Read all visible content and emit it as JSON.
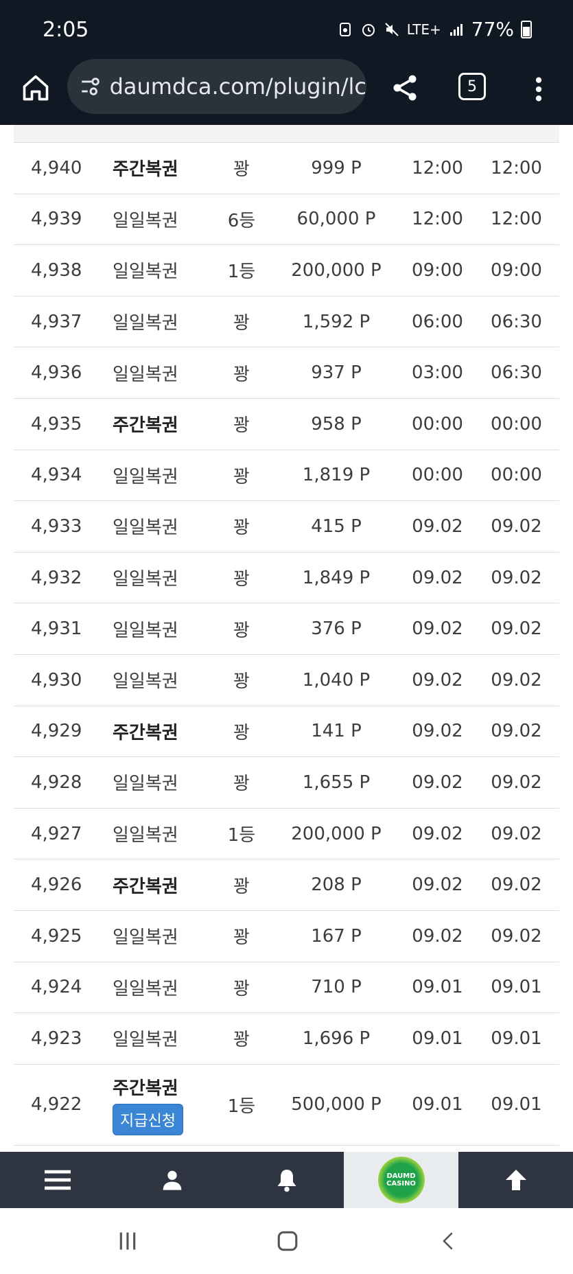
{
  "status": {
    "time": "2:05",
    "network": "LTE+",
    "battery": "77%"
  },
  "browser": {
    "url": "daumdca.com/plugin/lc",
    "tab_count": "5"
  },
  "rows": [
    {
      "no": "4,940",
      "type": "주간복권",
      "bold": true,
      "rank": "꽝",
      "points": "999 P",
      "t1": "12:00",
      "t2": "12:00"
    },
    {
      "no": "4,939",
      "type": "일일복권",
      "bold": false,
      "rank": "6등",
      "points": "60,000 P",
      "t1": "12:00",
      "t2": "12:00"
    },
    {
      "no": "4,938",
      "type": "일일복권",
      "bold": false,
      "rank": "1등",
      "points": "200,000 P",
      "t1": "09:00",
      "t2": "09:00"
    },
    {
      "no": "4,937",
      "type": "일일복권",
      "bold": false,
      "rank": "꽝",
      "points": "1,592 P",
      "t1": "06:00",
      "t2": "06:30"
    },
    {
      "no": "4,936",
      "type": "일일복권",
      "bold": false,
      "rank": "꽝",
      "points": "937 P",
      "t1": "03:00",
      "t2": "06:30"
    },
    {
      "no": "4,935",
      "type": "주간복권",
      "bold": true,
      "rank": "꽝",
      "points": "958 P",
      "t1": "00:00",
      "t2": "00:00"
    },
    {
      "no": "4,934",
      "type": "일일복권",
      "bold": false,
      "rank": "꽝",
      "points": "1,819 P",
      "t1": "00:00",
      "t2": "00:00"
    },
    {
      "no": "4,933",
      "type": "일일복권",
      "bold": false,
      "rank": "꽝",
      "points": "415 P",
      "t1": "09.02",
      "t2": "09.02"
    },
    {
      "no": "4,932",
      "type": "일일복권",
      "bold": false,
      "rank": "꽝",
      "points": "1,849 P",
      "t1": "09.02",
      "t2": "09.02"
    },
    {
      "no": "4,931",
      "type": "일일복권",
      "bold": false,
      "rank": "꽝",
      "points": "376 P",
      "t1": "09.02",
      "t2": "09.02"
    },
    {
      "no": "4,930",
      "type": "일일복권",
      "bold": false,
      "rank": "꽝",
      "points": "1,040 P",
      "t1": "09.02",
      "t2": "09.02"
    },
    {
      "no": "4,929",
      "type": "주간복권",
      "bold": true,
      "rank": "꽝",
      "points": "141 P",
      "t1": "09.02",
      "t2": "09.02"
    },
    {
      "no": "4,928",
      "type": "일일복권",
      "bold": false,
      "rank": "꽝",
      "points": "1,655 P",
      "t1": "09.02",
      "t2": "09.02"
    },
    {
      "no": "4,927",
      "type": "일일복권",
      "bold": false,
      "rank": "1등",
      "points": "200,000 P",
      "t1": "09.02",
      "t2": "09.02"
    },
    {
      "no": "4,926",
      "type": "주간복권",
      "bold": true,
      "rank": "꽝",
      "points": "208 P",
      "t1": "09.02",
      "t2": "09.02"
    },
    {
      "no": "4,925",
      "type": "일일복권",
      "bold": false,
      "rank": "꽝",
      "points": "167 P",
      "t1": "09.02",
      "t2": "09.02"
    },
    {
      "no": "4,924",
      "type": "일일복권",
      "bold": false,
      "rank": "꽝",
      "points": "710 P",
      "t1": "09.01",
      "t2": "09.01"
    },
    {
      "no": "4,923",
      "type": "일일복권",
      "bold": false,
      "rank": "꽝",
      "points": "1,696 P",
      "t1": "09.01",
      "t2": "09.01"
    },
    {
      "no": "4,922",
      "type": "주간복권",
      "bold": true,
      "rank": "1등",
      "points": "500,000 P",
      "t1": "09.01",
      "t2": "09.01",
      "claim": "지급신청"
    }
  ],
  "bottom_nav": {
    "items": [
      "menu-icon",
      "user-icon",
      "bell-icon",
      "daumd-casino-logo",
      "arrow-up-icon"
    ],
    "logo_text": "DAUMD CASINO"
  },
  "colors": {
    "bar_bg": "#0f1823",
    "nav_bg": "#2e3540",
    "claim_button": "#3a86d4"
  }
}
